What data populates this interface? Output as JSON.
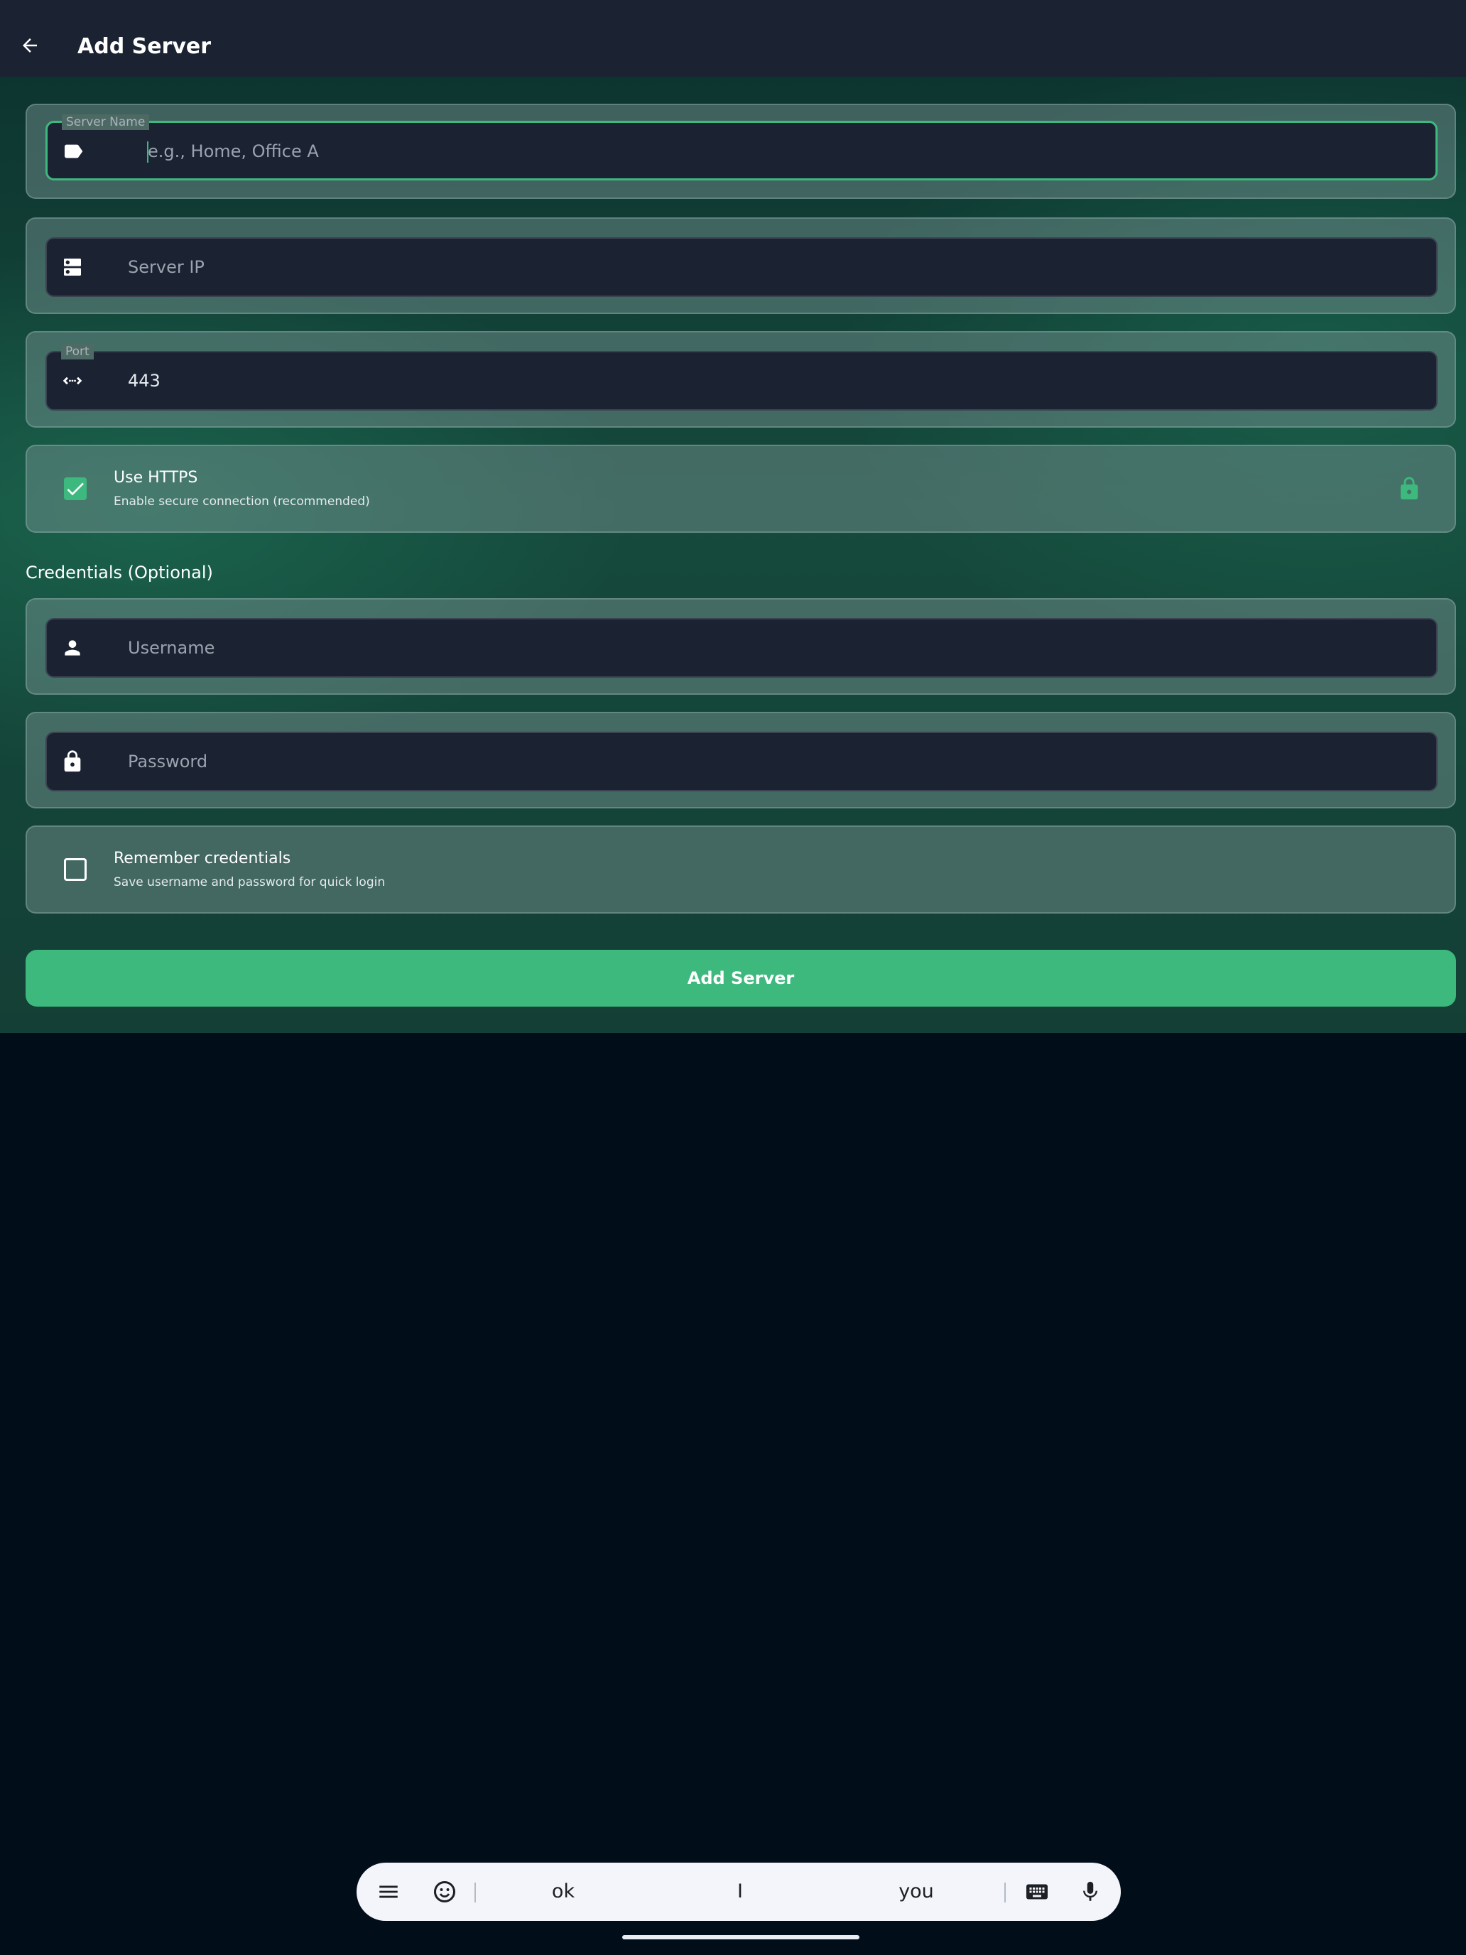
{
  "app_bar": {
    "title": "Add Server",
    "back_icon": "arrow-back-icon"
  },
  "form": {
    "server_name": {
      "label": "Server Name",
      "placeholder": "e.g., Home, Office A",
      "icon": "label-tag-icon",
      "focused": true
    },
    "server_ip": {
      "placeholder": "Server IP",
      "icon": "dns-server-icon"
    },
    "port": {
      "label": "Port",
      "value": "443",
      "icon": "code-arrows-icon"
    },
    "https": {
      "title": "Use HTTPS",
      "subtitle": "Enable secure connection (recommended)",
      "checked": true,
      "icon": "lock-icon"
    },
    "credentials_title": "Credentials (Optional)",
    "username": {
      "placeholder": "Username",
      "icon": "person-icon"
    },
    "password": {
      "placeholder": "Password",
      "icon": "lock-icon"
    },
    "remember": {
      "title": "Remember credentials",
      "subtitle": "Save username and password for quick login",
      "checked": false
    },
    "submit_label": "Add Server"
  },
  "keyboard": {
    "suggestions": [
      "ok",
      "I",
      "you"
    ],
    "icons": [
      "menu-icon",
      "emoji-icon",
      "keyboard-icon",
      "mic-icon"
    ]
  },
  "colors": {
    "accent": "#3db97e",
    "app_bar": "#1b2232",
    "field_bg": "#1b2232",
    "page_bg": "#010d18"
  }
}
